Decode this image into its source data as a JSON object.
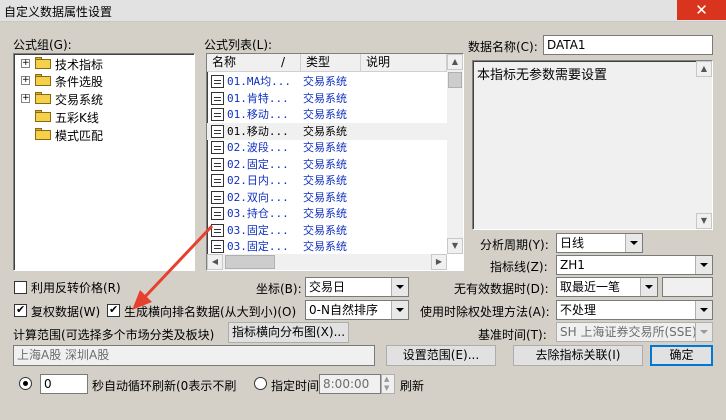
{
  "window": {
    "title": "自定义数据属性设置",
    "close_glyph": "✕"
  },
  "formula_group": {
    "label": "公式组(G):",
    "items": [
      {
        "label": "技术指标",
        "expanded": false
      },
      {
        "label": "条件选股",
        "expanded": false
      },
      {
        "label": "交易系统",
        "expanded": false
      },
      {
        "label": "五彩K线",
        "expanded": null
      },
      {
        "label": "模式匹配",
        "expanded": null
      }
    ]
  },
  "formula_list": {
    "label": "公式列表(L):",
    "headers": {
      "name": "名称",
      "sep": "/",
      "type": "类型",
      "desc": "说明"
    },
    "rows": [
      {
        "name": "01.MA均...",
        "type": "交易系统",
        "selected": false
      },
      {
        "name": "01.肯特...",
        "type": "交易系统",
        "selected": false
      },
      {
        "name": "01.移动...",
        "type": "交易系统",
        "selected": false
      },
      {
        "name": "01.移动...",
        "type": "交易系统",
        "selected": true
      },
      {
        "name": "02.波段...",
        "type": "交易系统",
        "selected": false
      },
      {
        "name": "02.固定...",
        "type": "交易系统",
        "selected": false
      },
      {
        "name": "02.日内...",
        "type": "交易系统",
        "selected": false
      },
      {
        "name": "02.双向...",
        "type": "交易系统",
        "selected": false
      },
      {
        "name": "03.持仓...",
        "type": "交易系统",
        "selected": false
      },
      {
        "name": "03.固定...",
        "type": "交易系统",
        "selected": false
      },
      {
        "name": "03.固定...",
        "type": "交易系统",
        "selected": false
      }
    ]
  },
  "data_name": {
    "label": "数据名称(C):",
    "value": "DATA1"
  },
  "description": {
    "text": "本指标无参数需要设置"
  },
  "period": {
    "label": "分析周期(Y):",
    "value": "日线"
  },
  "indicator_line": {
    "label": "指标线(Z):",
    "value": "ZH1"
  },
  "reverse_price": {
    "label": "利用反转价格(R)",
    "checked": false
  },
  "coordinate": {
    "label": "坐标(B):",
    "value": "交易日"
  },
  "invalid_data": {
    "label": "无有效数据时(D):",
    "value": "取最近一笔",
    "extra": ""
  },
  "restore_data": {
    "label": "复权数据(W)",
    "checked": true
  },
  "rank_data": {
    "label": "生成横向排名数据(从大到小)(O)",
    "checked": true
  },
  "rank_order": {
    "value": "0-N自然排序"
  },
  "timeshare_method": {
    "label": "使用时除权处理方法(A):",
    "value": "不处理"
  },
  "calc_range": {
    "label": "计算范围(可选择多个市场分类及板块)",
    "value": "上海A股  深圳A股"
  },
  "dist_button": {
    "label": "指标横向分布图(X)..."
  },
  "base_time": {
    "label": "基准时间(T):",
    "value": "SH 上海证券交易所(SSE)"
  },
  "buttons": {
    "set_range": "设置范围(E)...",
    "remove_link": "去除指标关联(I)",
    "ok": "确定"
  },
  "refresh": {
    "value": "0",
    "label": "秒自动循环刷新(0表示不刷",
    "specified_label": "指定时间",
    "time": "8:00:00",
    "suffix": "刷新"
  },
  "colors": {
    "accent": "#0078d7",
    "close": "#d8341e",
    "arrow": "#e8402e",
    "link_text": "#1030c0"
  }
}
